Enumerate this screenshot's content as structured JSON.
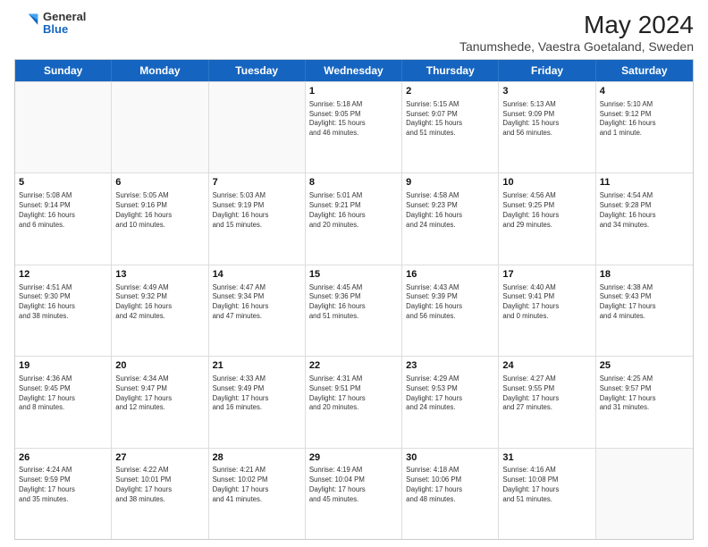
{
  "logo": {
    "general": "General",
    "blue": "Blue"
  },
  "title": "May 2024",
  "subtitle": "Tanumshede, Vaestra Goetaland, Sweden",
  "headers": [
    "Sunday",
    "Monday",
    "Tuesday",
    "Wednesday",
    "Thursday",
    "Friday",
    "Saturday"
  ],
  "rows": [
    [
      {
        "day": "",
        "lines": []
      },
      {
        "day": "",
        "lines": []
      },
      {
        "day": "",
        "lines": []
      },
      {
        "day": "1",
        "lines": [
          "Sunrise: 5:18 AM",
          "Sunset: 9:05 PM",
          "Daylight: 15 hours",
          "and 46 minutes."
        ]
      },
      {
        "day": "2",
        "lines": [
          "Sunrise: 5:15 AM",
          "Sunset: 9:07 PM",
          "Daylight: 15 hours",
          "and 51 minutes."
        ]
      },
      {
        "day": "3",
        "lines": [
          "Sunrise: 5:13 AM",
          "Sunset: 9:09 PM",
          "Daylight: 15 hours",
          "and 56 minutes."
        ]
      },
      {
        "day": "4",
        "lines": [
          "Sunrise: 5:10 AM",
          "Sunset: 9:12 PM",
          "Daylight: 16 hours",
          "and 1 minute."
        ]
      }
    ],
    [
      {
        "day": "5",
        "lines": [
          "Sunrise: 5:08 AM",
          "Sunset: 9:14 PM",
          "Daylight: 16 hours",
          "and 6 minutes."
        ]
      },
      {
        "day": "6",
        "lines": [
          "Sunrise: 5:05 AM",
          "Sunset: 9:16 PM",
          "Daylight: 16 hours",
          "and 10 minutes."
        ]
      },
      {
        "day": "7",
        "lines": [
          "Sunrise: 5:03 AM",
          "Sunset: 9:19 PM",
          "Daylight: 16 hours",
          "and 15 minutes."
        ]
      },
      {
        "day": "8",
        "lines": [
          "Sunrise: 5:01 AM",
          "Sunset: 9:21 PM",
          "Daylight: 16 hours",
          "and 20 minutes."
        ]
      },
      {
        "day": "9",
        "lines": [
          "Sunrise: 4:58 AM",
          "Sunset: 9:23 PM",
          "Daylight: 16 hours",
          "and 24 minutes."
        ]
      },
      {
        "day": "10",
        "lines": [
          "Sunrise: 4:56 AM",
          "Sunset: 9:25 PM",
          "Daylight: 16 hours",
          "and 29 minutes."
        ]
      },
      {
        "day": "11",
        "lines": [
          "Sunrise: 4:54 AM",
          "Sunset: 9:28 PM",
          "Daylight: 16 hours",
          "and 34 minutes."
        ]
      }
    ],
    [
      {
        "day": "12",
        "lines": [
          "Sunrise: 4:51 AM",
          "Sunset: 9:30 PM",
          "Daylight: 16 hours",
          "and 38 minutes."
        ]
      },
      {
        "day": "13",
        "lines": [
          "Sunrise: 4:49 AM",
          "Sunset: 9:32 PM",
          "Daylight: 16 hours",
          "and 42 minutes."
        ]
      },
      {
        "day": "14",
        "lines": [
          "Sunrise: 4:47 AM",
          "Sunset: 9:34 PM",
          "Daylight: 16 hours",
          "and 47 minutes."
        ]
      },
      {
        "day": "15",
        "lines": [
          "Sunrise: 4:45 AM",
          "Sunset: 9:36 PM",
          "Daylight: 16 hours",
          "and 51 minutes."
        ]
      },
      {
        "day": "16",
        "lines": [
          "Sunrise: 4:43 AM",
          "Sunset: 9:39 PM",
          "Daylight: 16 hours",
          "and 56 minutes."
        ]
      },
      {
        "day": "17",
        "lines": [
          "Sunrise: 4:40 AM",
          "Sunset: 9:41 PM",
          "Daylight: 17 hours",
          "and 0 minutes."
        ]
      },
      {
        "day": "18",
        "lines": [
          "Sunrise: 4:38 AM",
          "Sunset: 9:43 PM",
          "Daylight: 17 hours",
          "and 4 minutes."
        ]
      }
    ],
    [
      {
        "day": "19",
        "lines": [
          "Sunrise: 4:36 AM",
          "Sunset: 9:45 PM",
          "Daylight: 17 hours",
          "and 8 minutes."
        ]
      },
      {
        "day": "20",
        "lines": [
          "Sunrise: 4:34 AM",
          "Sunset: 9:47 PM",
          "Daylight: 17 hours",
          "and 12 minutes."
        ]
      },
      {
        "day": "21",
        "lines": [
          "Sunrise: 4:33 AM",
          "Sunset: 9:49 PM",
          "Daylight: 17 hours",
          "and 16 minutes."
        ]
      },
      {
        "day": "22",
        "lines": [
          "Sunrise: 4:31 AM",
          "Sunset: 9:51 PM",
          "Daylight: 17 hours",
          "and 20 minutes."
        ]
      },
      {
        "day": "23",
        "lines": [
          "Sunrise: 4:29 AM",
          "Sunset: 9:53 PM",
          "Daylight: 17 hours",
          "and 24 minutes."
        ]
      },
      {
        "day": "24",
        "lines": [
          "Sunrise: 4:27 AM",
          "Sunset: 9:55 PM",
          "Daylight: 17 hours",
          "and 27 minutes."
        ]
      },
      {
        "day": "25",
        "lines": [
          "Sunrise: 4:25 AM",
          "Sunset: 9:57 PM",
          "Daylight: 17 hours",
          "and 31 minutes."
        ]
      }
    ],
    [
      {
        "day": "26",
        "lines": [
          "Sunrise: 4:24 AM",
          "Sunset: 9:59 PM",
          "Daylight: 17 hours",
          "and 35 minutes."
        ]
      },
      {
        "day": "27",
        "lines": [
          "Sunrise: 4:22 AM",
          "Sunset: 10:01 PM",
          "Daylight: 17 hours",
          "and 38 minutes."
        ]
      },
      {
        "day": "28",
        "lines": [
          "Sunrise: 4:21 AM",
          "Sunset: 10:02 PM",
          "Daylight: 17 hours",
          "and 41 minutes."
        ]
      },
      {
        "day": "29",
        "lines": [
          "Sunrise: 4:19 AM",
          "Sunset: 10:04 PM",
          "Daylight: 17 hours",
          "and 45 minutes."
        ]
      },
      {
        "day": "30",
        "lines": [
          "Sunrise: 4:18 AM",
          "Sunset: 10:06 PM",
          "Daylight: 17 hours",
          "and 48 minutes."
        ]
      },
      {
        "day": "31",
        "lines": [
          "Sunrise: 4:16 AM",
          "Sunset: 10:08 PM",
          "Daylight: 17 hours",
          "and 51 minutes."
        ]
      },
      {
        "day": "",
        "lines": []
      }
    ]
  ]
}
